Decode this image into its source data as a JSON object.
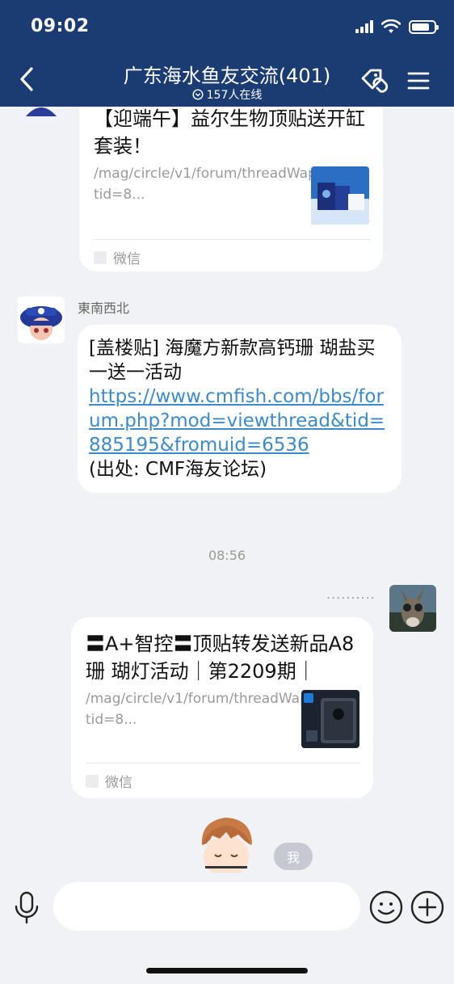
{
  "status": {
    "time": "09:02",
    "battery_level": 0.8
  },
  "header": {
    "title": "广东海水鱼友交流(401)",
    "online_text": "157人在线",
    "back_icon": "chevron-left-icon",
    "tag_icon": "tag-link-icon",
    "menu_icon": "hamburger-menu-icon"
  },
  "messages": {
    "card1": {
      "title": "【迎端午】益尔生物顶贴送开缸套装！",
      "link": "/mag/circle/v1/forum/threadWapPage?tid=8...",
      "source": "微信"
    },
    "msg2": {
      "sender": "東南西北",
      "text_prefix": "[盖楼贴] 海魔方新款高钙珊 瑚盐买一送一活动",
      "url": "https://www.cmfish.com/bbs/forum.php?mod=viewthread&tid=885195&fromuid=6536",
      "text_suffix": "(出处: CMF海友论坛)"
    },
    "timestamp": "08:56",
    "own_name_dots": "..........",
    "card2": {
      "title": "〓A+智控〓顶贴转发送新品A8珊 瑚灯活动｜第2209期｜",
      "link": "/mag/circle/v1/forum/threadWapPage?tid=8...",
      "source": "微信"
    },
    "me_tag": "我"
  },
  "input": {
    "placeholder": "",
    "voice_icon": "microphone-icon",
    "emoji_icon": "smiley-icon",
    "plus_icon": "plus-circle-icon"
  },
  "colors": {
    "header_bg": "#1b3c72",
    "link": "#3c8acb",
    "background": "#f1f2f6"
  }
}
